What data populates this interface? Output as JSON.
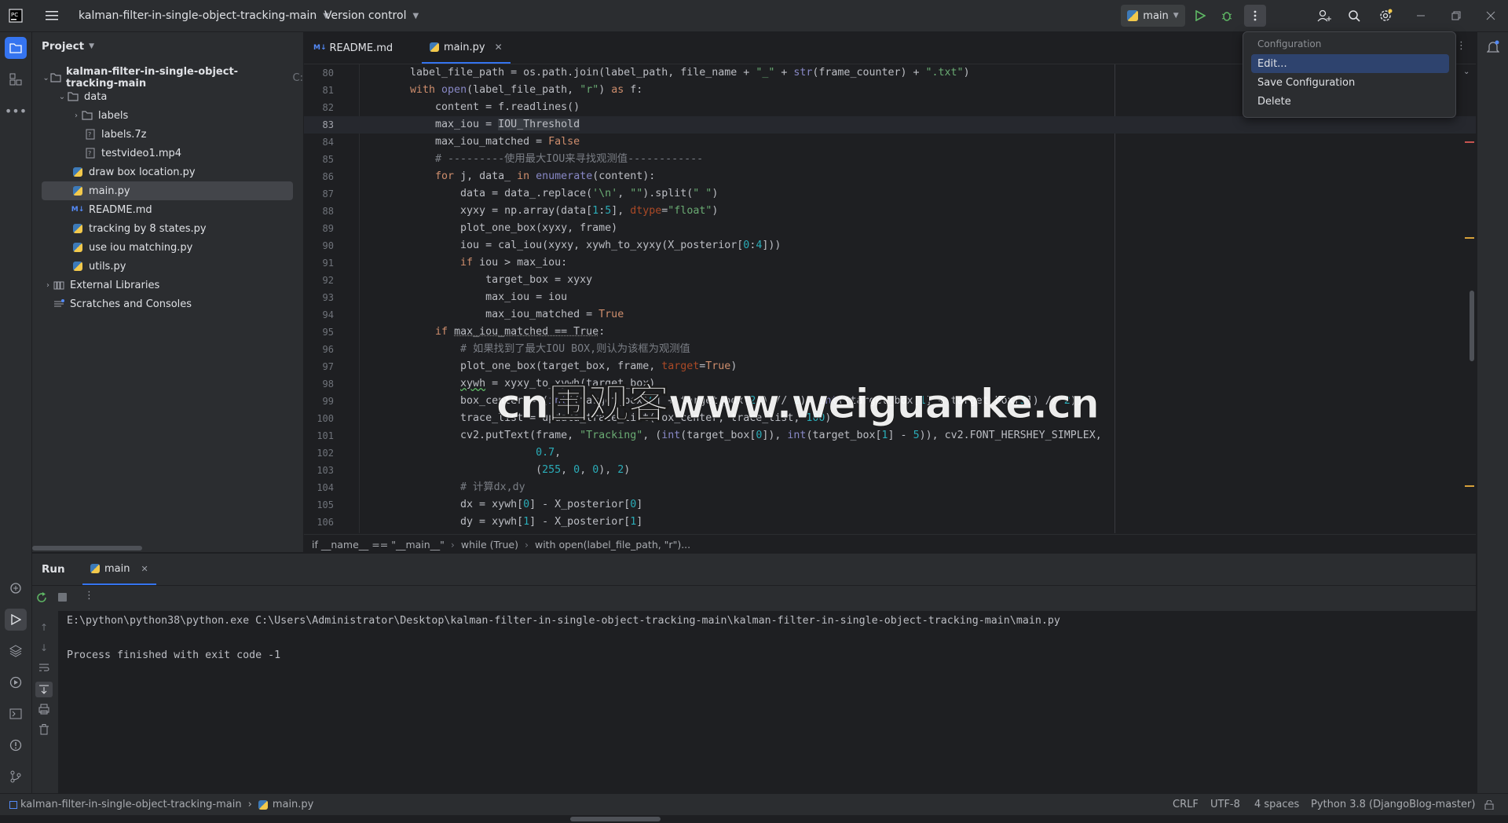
{
  "topbar": {
    "project_name": "kalman-filter-in-single-object-tracking-main",
    "vcs": "Version control",
    "run_config": "main"
  },
  "popup": {
    "header": "Configuration",
    "items": [
      "Edit...",
      "Save Configuration",
      "Delete"
    ]
  },
  "project_panel": {
    "title": "Project",
    "tree": [
      {
        "label": "kalman-filter-in-single-object-tracking-main",
        "suffix": "C:",
        "type": "folder",
        "expanded": true
      },
      {
        "label": "data",
        "type": "folder",
        "expanded": true
      },
      {
        "label": "labels",
        "type": "folder",
        "expanded": false
      },
      {
        "label": "labels.7z",
        "type": "file"
      },
      {
        "label": "testvideo1.mp4",
        "type": "file"
      },
      {
        "label": "draw box location.py",
        "type": "python"
      },
      {
        "label": "main.py",
        "type": "python",
        "selected": true
      },
      {
        "label": "README.md",
        "type": "markdown"
      },
      {
        "label": "tracking by 8 states.py",
        "type": "python"
      },
      {
        "label": "use iou matching.py",
        "type": "python"
      },
      {
        "label": "utils.py",
        "type": "python"
      },
      {
        "label": "External Libraries",
        "type": "library"
      },
      {
        "label": "Scratches and Consoles",
        "type": "scratch"
      }
    ]
  },
  "tabs": [
    {
      "label": "README.md",
      "badge": "M↓"
    },
    {
      "label": "main.py",
      "active": true
    }
  ],
  "editor": {
    "line_numbers": [
      "80",
      "81",
      "82",
      "83",
      "84",
      "85",
      "86",
      "87",
      "88",
      "89",
      "90",
      "91",
      "92",
      "93",
      "94",
      "95",
      "96",
      "97",
      "98",
      "99",
      "100",
      "101",
      "102",
      "103",
      "104",
      "105",
      "106"
    ]
  },
  "breadcrumbs": [
    "if __name__ == \"__main__\"",
    "while (True)",
    "with open(label_file_path, \"r\")..."
  ],
  "run_panel": {
    "tab_run": "Run",
    "tab_main": "main",
    "console_line1": "E:\\python\\python38\\python.exe C:\\Users\\Administrator\\Desktop\\kalman-filter-in-single-object-tracking-main\\kalman-filter-in-single-object-tracking-main\\main.py",
    "console_line2": "Process finished with exit code -1"
  },
  "status": {
    "path_project": "kalman-filter-in-single-object-tracking-main",
    "path_file": "main.py",
    "line_sep": "CRLF",
    "encoding": "UTF-8",
    "indent": "4 spaces",
    "interpreter": "Python 3.8 (DjangoBlog-master)"
  },
  "watermark": "cn围观客www.weiguanke.cn",
  "colors": {
    "accent": "#3574f0",
    "bg": "#1e1f22",
    "panel": "#2b2d30"
  }
}
